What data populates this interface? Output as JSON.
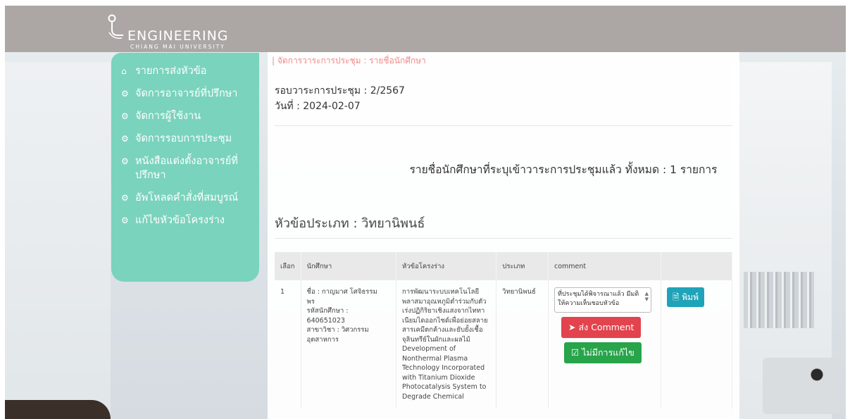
{
  "brand": {
    "name": "ENGINEERING",
    "sub": "CHIANG MAI UNIVERSITY"
  },
  "sidebar": {
    "items": [
      {
        "icon": "home-icon",
        "label": "รายการส่งหัวข้อ"
      },
      {
        "icon": "gear-icon",
        "label": "จัดการอาจารย์ที่ปรึกษา"
      },
      {
        "icon": "gear-icon",
        "label": "จัดการผู้ใช้งาน"
      },
      {
        "icon": "gear-icon",
        "label": "จัดการรอบการประชุม"
      },
      {
        "icon": "gear-icon",
        "label": "หนังสือแต่งตั้งอาจารย์ที่ปรึกษา"
      },
      {
        "icon": "gear-icon",
        "label": "อัพโหลดคำสั่งที่สมบูรณ์"
      },
      {
        "icon": "gear-icon",
        "label": "แก้ไขหัวข้อโครงร่าง"
      }
    ]
  },
  "breadcrumb": "| จัดการวาระการประชุม : รายชื่อนักศึกษา",
  "meeting": {
    "round": "รอบวาระการประชุม : 2/2567",
    "date": "วันที่ : 2024-02-07"
  },
  "summary": "รายชื่อนักศึกษาที่ระบุเข้าวาระการประชุมแล้ว ทั้งหมด : 1 รายการ",
  "category": "หัวข้อประเภท : วิทยานิพนธ์",
  "table": {
    "headers": [
      "เลือก",
      "นักศึกษา",
      "หัวข้อโครงร่าง",
      "ประเภท",
      "comment",
      ""
    ],
    "rows": [
      {
        "index": "1",
        "student": [
          "ชื่อ : กาญมาศ โศจิธรรม",
          "พร",
          "รหัสนักศึกษา :",
          "640651023",
          "สาขาวิชา : วิศวกรรม",
          "อุตสาหการ"
        ],
        "title": [
          "การพัฒนาระบบเทคโนโลยี",
          "พลาสมาอุณหภูมิต่ำร่วมกับตัว",
          "เร่งปฏิกิริยาเชิงแสงจากไททา",
          "เนียมไดออกไซด์เพื่อย่อยสลาย",
          "สารเคมีตกค้างและยับยั้งเชื้อ",
          "จุลินทรีย์ในผักและผลไม้",
          "Development of",
          "Nonthermal Plasma",
          "Technology Incorporated",
          "with Titanium Dioxide",
          "Photocatalysis System to",
          "Degrade Chemical"
        ],
        "type": "วิทยานิพนธ์",
        "comment_value": "ที่ประชุมได้พิจารณาแล้ว มีมติให้ความเห็นชอบหัวข้อ",
        "send_label": "ส่ง Comment",
        "no_edit_label": "ไม่มีการแก้ไข",
        "print_label": "พิมพ์"
      }
    ]
  },
  "colors": {
    "sidebar": "#7ad3bd",
    "topbar": "#aca7a5",
    "breadcrumb": "#f08a8a",
    "send": "#e2434d",
    "noedit": "#28a44b",
    "print": "#1fa3b8"
  }
}
